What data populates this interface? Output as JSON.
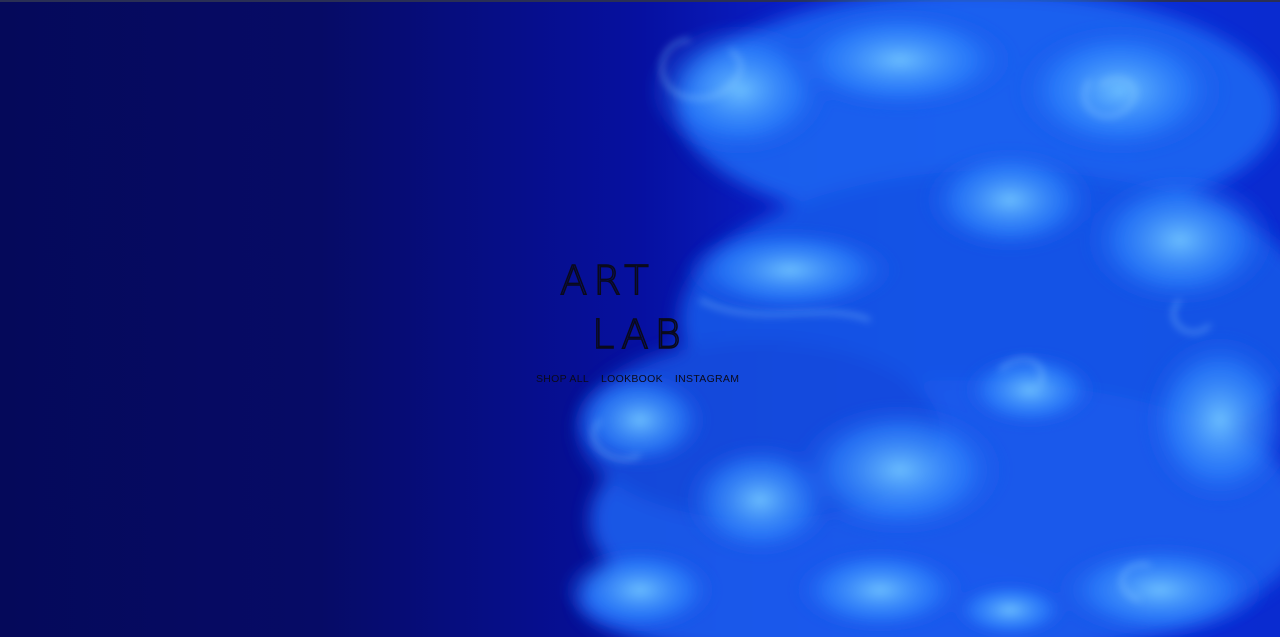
{
  "brand": {
    "logo_line1": "ART",
    "logo_line2": "LAB"
  },
  "nav": {
    "items": [
      {
        "label": "SHOP ALL"
      },
      {
        "label": "LOOKBOOK"
      },
      {
        "label": "INSTAGRAM"
      }
    ]
  },
  "colors": {
    "background_dark": "#05095a",
    "smoke_light": "#4aa6ff",
    "smoke_mid": "#1c63f0",
    "logo_ink": "#0a0a1a"
  },
  "hero": {
    "image_subject": "blue ink smoke in water"
  }
}
